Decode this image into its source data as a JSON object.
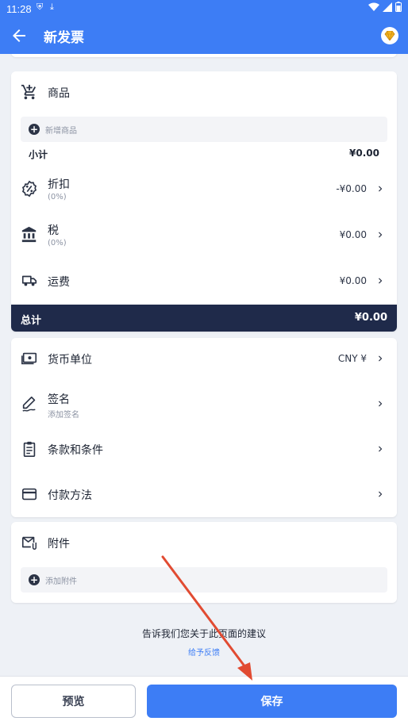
{
  "status_bar": {
    "time": "11:28"
  },
  "app_bar": {
    "title": "新发票"
  },
  "items_section": {
    "label": "商品",
    "add_label": "新增商品",
    "subtotal_label": "小计",
    "subtotal_value": "¥0.00"
  },
  "adjustments": [
    {
      "label": "折扣",
      "sub": "(0%)",
      "value": "-¥0.00"
    },
    {
      "label": "税",
      "sub": "(0%)",
      "value": "¥0.00"
    },
    {
      "label": "运费",
      "value": "¥0.00"
    }
  ],
  "total": {
    "label": "总计",
    "value": "¥0.00"
  },
  "settings": [
    {
      "label": "货币单位",
      "value": "CNY ¥"
    },
    {
      "label": "签名",
      "sub": "添加签名"
    },
    {
      "label": "条款和条件"
    },
    {
      "label": "付款方法"
    }
  ],
  "attachments": {
    "label": "附件",
    "add_label": "添加附件"
  },
  "feedback": {
    "question": "告诉我们您关于此页面的建议",
    "link": "给予反馈"
  },
  "buttons": {
    "preview": "预览",
    "save": "保存"
  },
  "colors": {
    "primary": "#3d7df5",
    "total_bar": "#1f2a4a",
    "annotation_arrow": "#e14b32"
  }
}
